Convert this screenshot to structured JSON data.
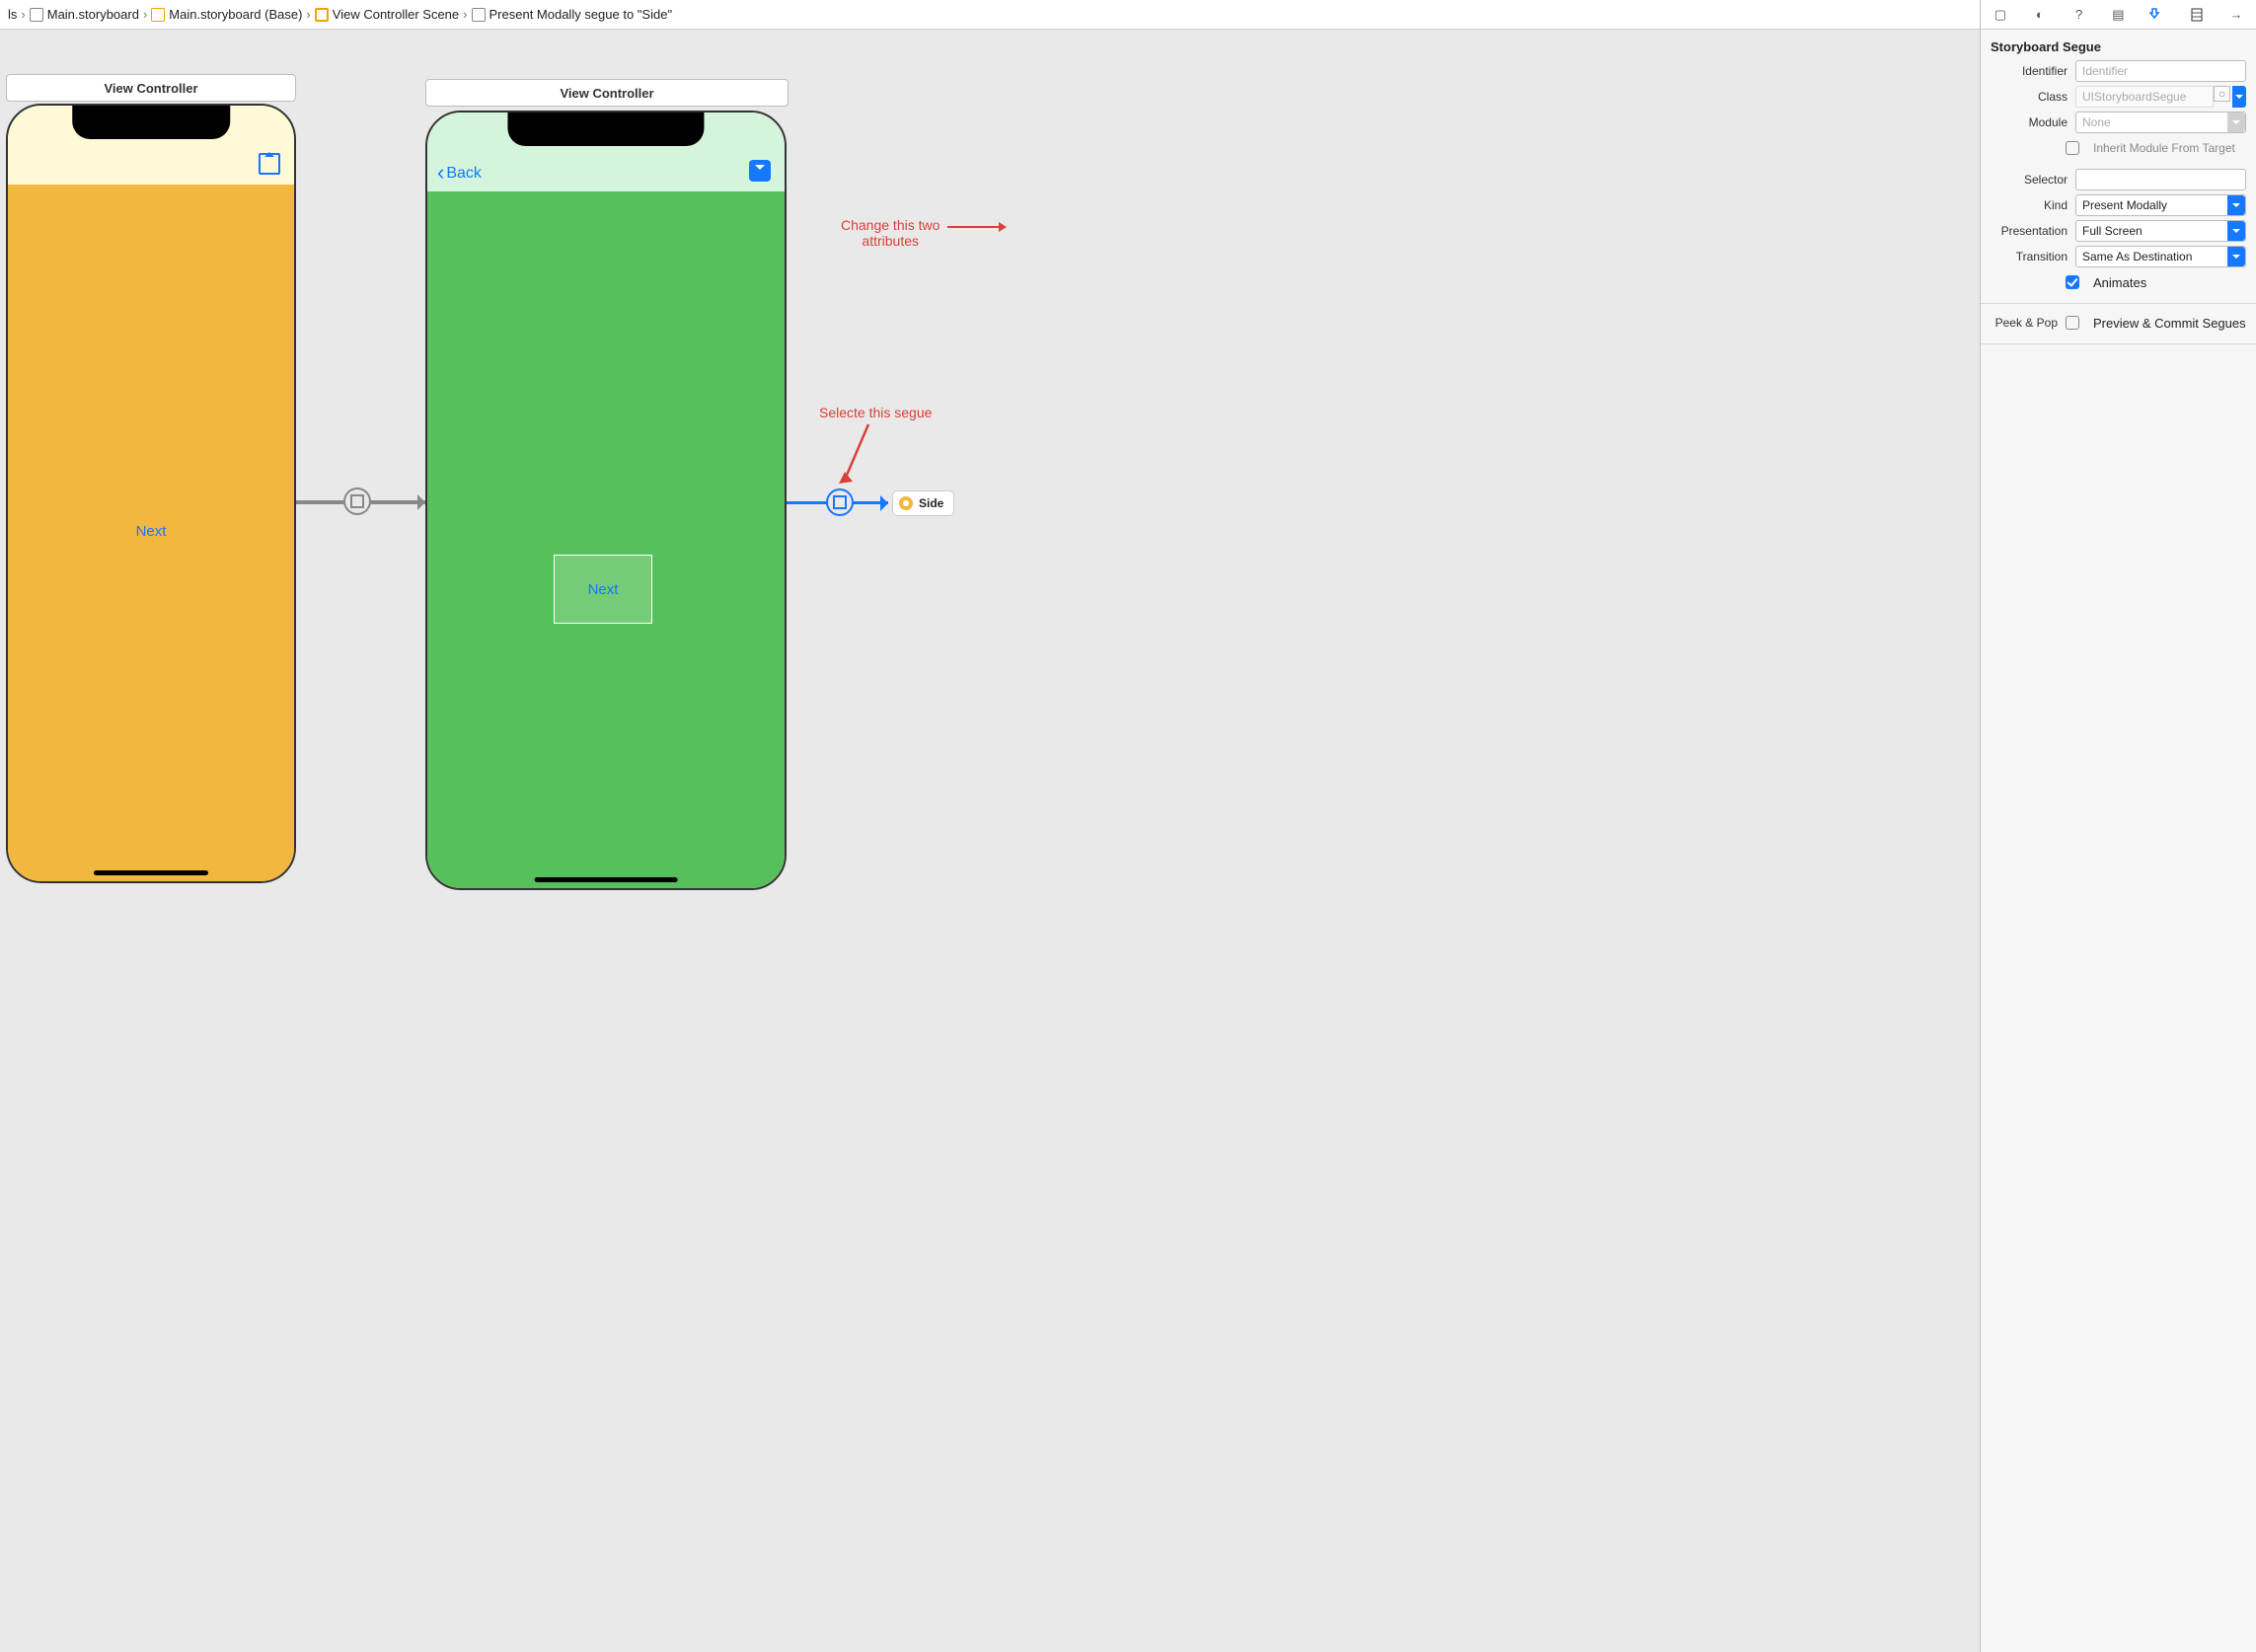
{
  "breadcrumbs": {
    "crumb0": "ls",
    "crumb1": "Main.storyboard",
    "crumb2": "Main.storyboard (Base)",
    "crumb3": "View Controller Scene",
    "crumb4": "Present Modally segue to \"Side\""
  },
  "scenes": {
    "a_label": "View Controller",
    "b_label": "View Controller",
    "a_button": "Next",
    "b_back": "Back",
    "b_button": "Next",
    "side_chip": "Side"
  },
  "annotations": {
    "change_line1": "Change this two",
    "change_line2": "attributes",
    "select_segue": "Selecte this segue"
  },
  "inspector": {
    "header": "Storyboard Segue",
    "identifier_label": "Identifier",
    "identifier_placeholder": "Identifier",
    "class_label": "Class",
    "class_value": "UIStoryboardSegue",
    "module_label": "Module",
    "module_value": "None",
    "inherit_label": "Inherit Module From Target",
    "selector_label": "Selector",
    "kind_label": "Kind",
    "kind_value": "Present Modally",
    "presentation_label": "Presentation",
    "presentation_value": "Full Screen",
    "transition_label": "Transition",
    "transition_value": "Same As Destination",
    "animates_label": "Animates",
    "peekpop_label": "Peek & Pop",
    "peekpop_text": "Preview & Commit Segues"
  }
}
